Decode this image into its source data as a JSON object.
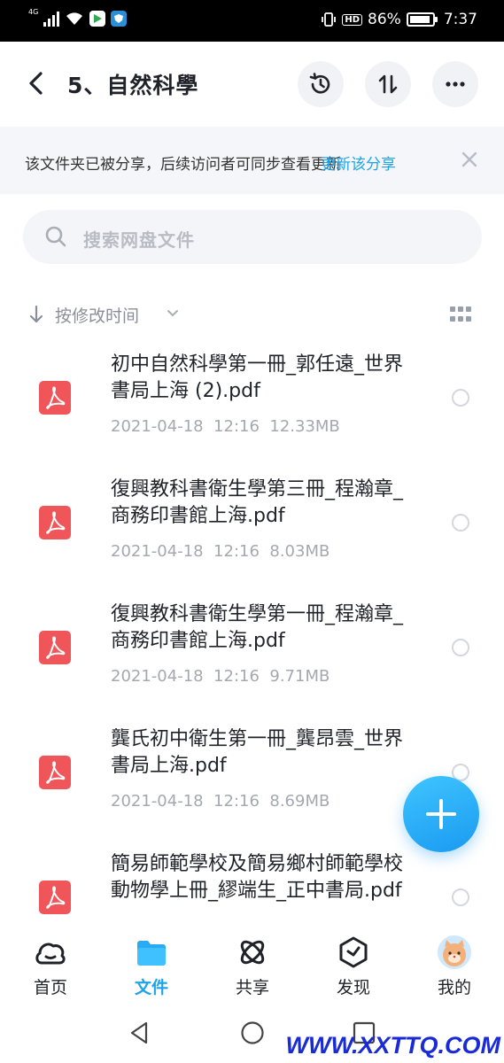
{
  "status_bar": {
    "network": "4G",
    "battery": "86%",
    "time": "7:37",
    "hd_badge": "HD"
  },
  "header": {
    "title": "5、自然科學",
    "back_icon": "back-arrow-icon",
    "history_icon": "history-icon",
    "transfer_icon": "transfer-icon",
    "more_icon": "more-icon"
  },
  "banner": {
    "text": "该文件夹已被分享，后续访问者可同步查看更新",
    "link": "更新该分享"
  },
  "search": {
    "placeholder": "搜索网盘文件"
  },
  "sort": {
    "label": "按修改时间"
  },
  "files": [
    {
      "name": "初中自然科學第一冊_郭任遠_世界書局上海 (2).pdf",
      "meta": "2021-04-18  12:16  12.33MB"
    },
    {
      "name": "復興教科書衛生學第三冊_程瀚章_商務印書館上海.pdf",
      "meta": "2021-04-18  12:16  8.03MB"
    },
    {
      "name": "復興教科書衛生學第一冊_程瀚章_商務印書館上海.pdf",
      "meta": "2021-04-18  12:16  9.71MB"
    },
    {
      "name": "龔氏初中衛生第一冊_龔昂雲_世界書局上海.pdf",
      "meta": "2021-04-18  12:16  8.69MB"
    },
    {
      "name": "簡易師範學校及簡易鄉村師範學校動物學上冊_繆端生_正中書局.pdf",
      "meta": ""
    }
  ],
  "bottom_nav": [
    {
      "label": "首页",
      "icon": "cloud-icon"
    },
    {
      "label": "文件",
      "icon": "folder-icon"
    },
    {
      "label": "共享",
      "icon": "atom-icon"
    },
    {
      "label": "发现",
      "icon": "compass-icon"
    },
    {
      "label": "我的",
      "icon": "avatar-icon"
    }
  ],
  "watermark": "WWW.XXTTQ.COM",
  "colors": {
    "accent": "#1ea3e8",
    "pdf": "#f0555a"
  }
}
